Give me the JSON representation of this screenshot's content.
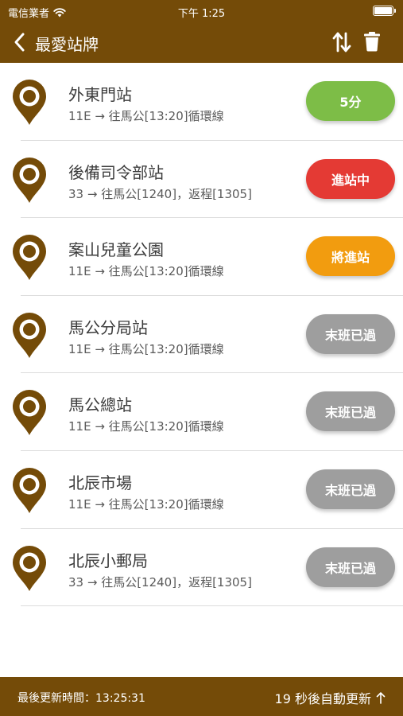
{
  "status_bar": {
    "carrier": "電信業者",
    "time": "下午 1:25"
  },
  "header": {
    "title": "最愛站牌"
  },
  "colors": {
    "brand": "#744b08",
    "arriving_soon": "#f29c0f",
    "minutes": "#7dbd47",
    "in_station": "#e43a34",
    "last_passed": "#9e9e9e"
  },
  "stops": [
    {
      "name": "外東門站",
      "route": "11E → 往馬公[13:20]循環線",
      "status": "5分",
      "status_type": "minutes"
    },
    {
      "name": "後備司令部站",
      "route": "33 → 往馬公[1240]，返程[1305]",
      "status": "進站中",
      "status_type": "in_station"
    },
    {
      "name": "案山兒童公園",
      "route": "11E → 往馬公[13:20]循環線",
      "status": "將進站",
      "status_type": "arriving_soon"
    },
    {
      "name": "馬公分局站",
      "route": "11E → 往馬公[13:20]循環線",
      "status": "末班已過",
      "status_type": "last_passed"
    },
    {
      "name": "馬公總站",
      "route": "11E → 往馬公[13:20]循環線",
      "status": "末班已過",
      "status_type": "last_passed"
    },
    {
      "name": "北辰市場",
      "route": "11E → 往馬公[13:20]循環線",
      "status": "末班已過",
      "status_type": "last_passed"
    },
    {
      "name": "北辰小郵局",
      "route": "33 → 往馬公[1240]，返程[1305]",
      "status": "末班已過",
      "status_type": "last_passed"
    }
  ],
  "footer": {
    "last_updated": "最後更新時間：13:25:31",
    "auto_refresh": "19 秒後自動更新"
  }
}
